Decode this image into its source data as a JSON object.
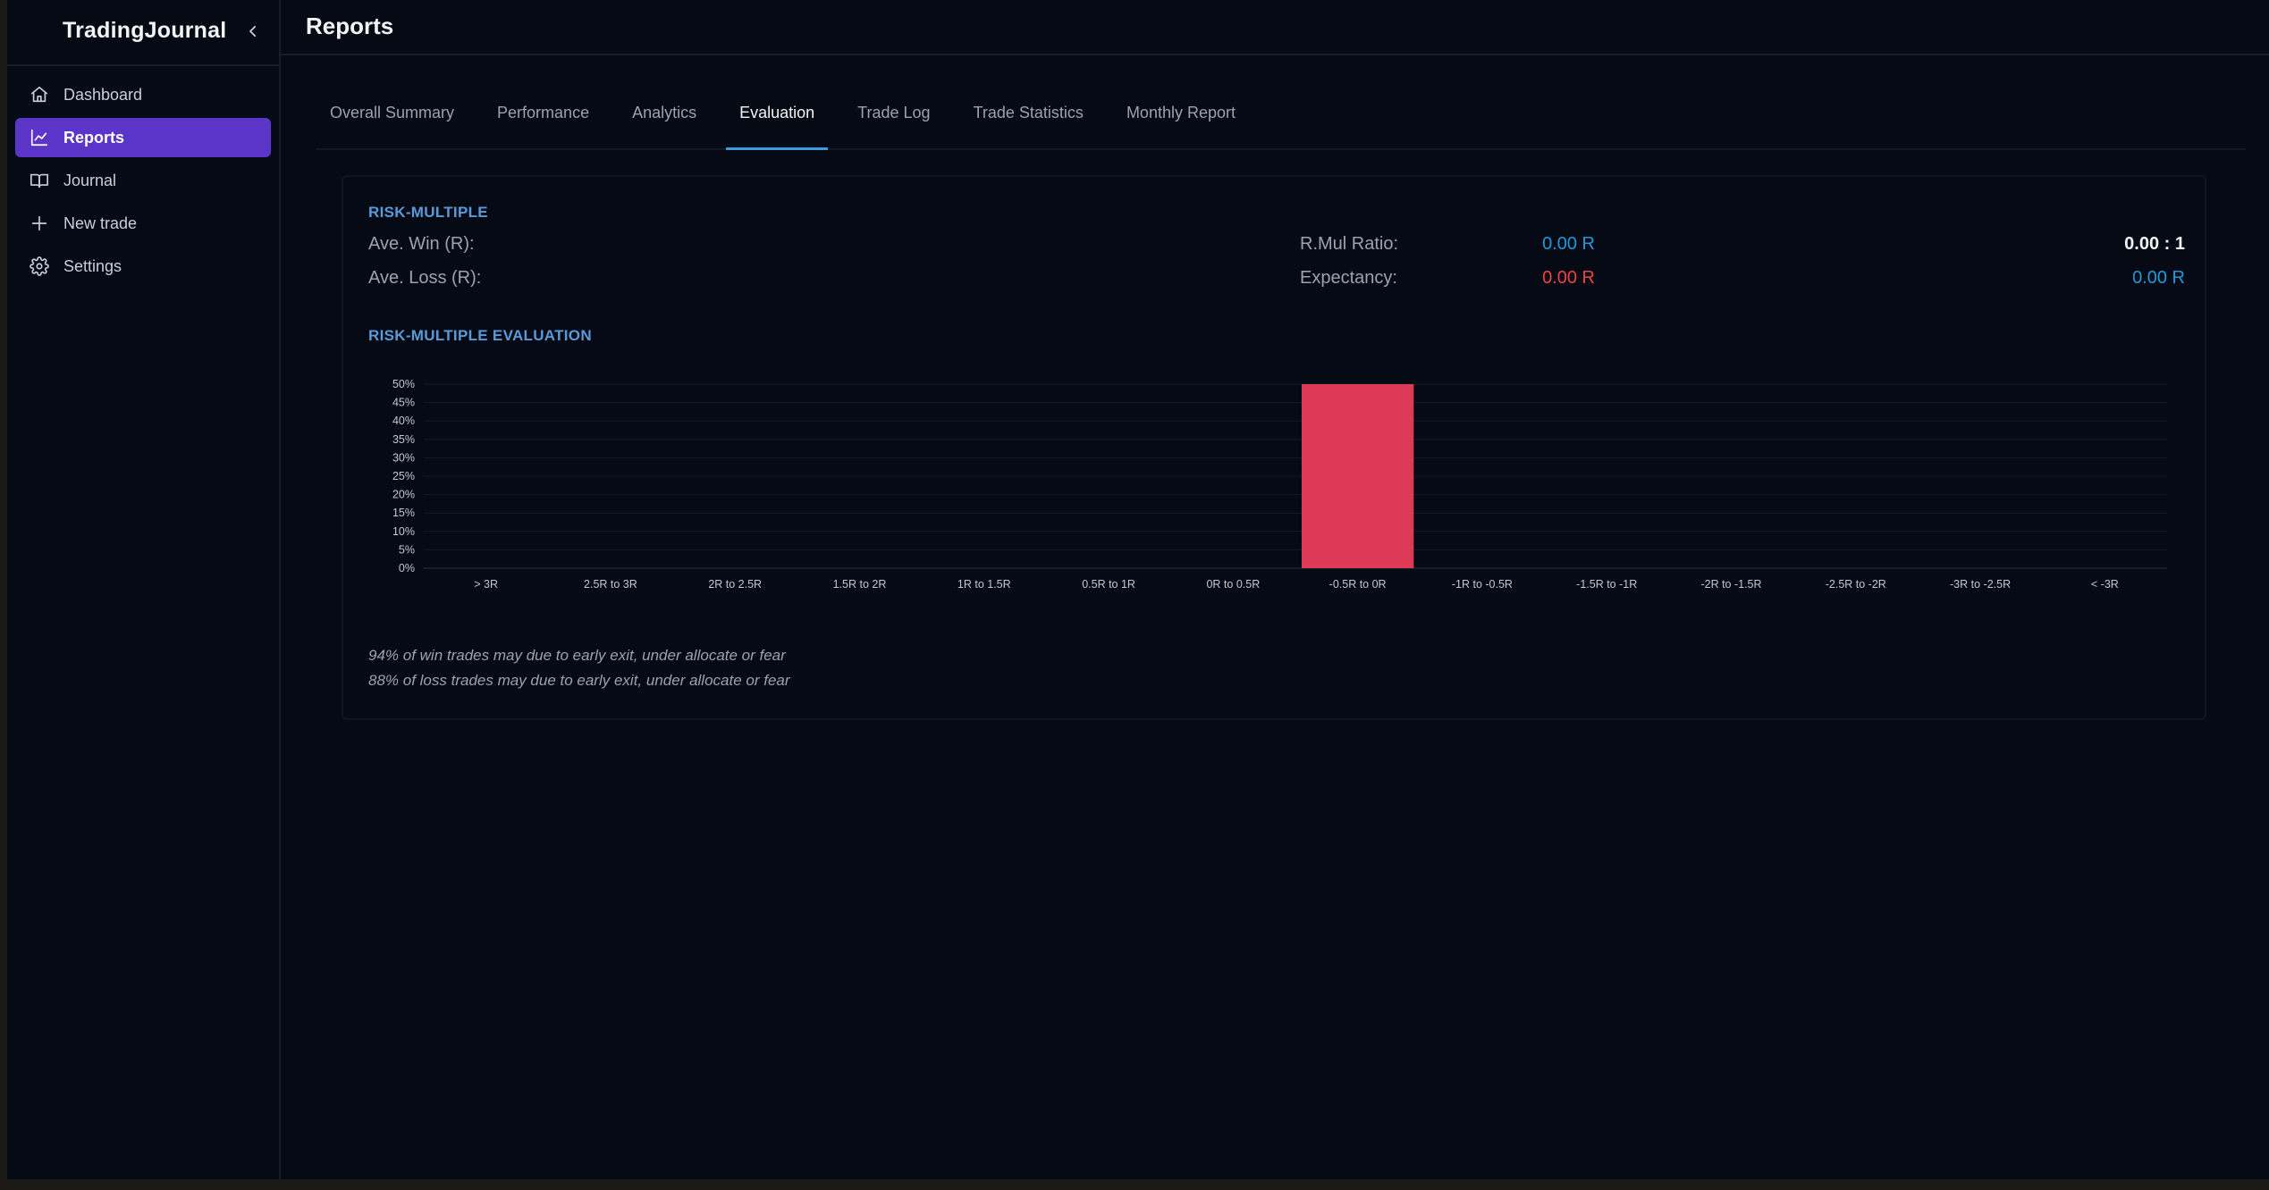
{
  "app": {
    "brand": "TradingJournal"
  },
  "sidebar": {
    "items": [
      {
        "label": "Dashboard",
        "icon": "home-icon"
      },
      {
        "label": "Reports",
        "icon": "chart-line-icon",
        "active": true
      },
      {
        "label": "Journal",
        "icon": "book-icon"
      },
      {
        "label": "New trade",
        "icon": "plus-icon"
      },
      {
        "label": "Settings",
        "icon": "gear-icon"
      }
    ]
  },
  "header": {
    "title": "Reports"
  },
  "tabs": [
    {
      "label": "Overall Summary"
    },
    {
      "label": "Performance"
    },
    {
      "label": "Analytics"
    },
    {
      "label": "Evaluation",
      "active": true
    },
    {
      "label": "Trade Log"
    },
    {
      "label": "Trade Statistics"
    },
    {
      "label": "Monthly Report"
    }
  ],
  "risk_multiple": {
    "title": "RISK-MULTIPLE",
    "ave_win_label": "Ave. Win (R):",
    "ave_win_value": "0.00 R",
    "ave_loss_label": "Ave. Loss (R):",
    "ave_loss_value": "0.00 R",
    "ratio_label": "R.Mul Ratio:",
    "ratio_value": "0.00 : 1",
    "expectancy_label": "Expectancy:",
    "expectancy_value": "0.00 R"
  },
  "evaluation": {
    "title": "RISK-MULTIPLE EVALUATION",
    "notes": [
      "94% of win trades may due to early exit, under allocate or fear",
      "88% of loss trades may due to early exit, under allocate or fear"
    ]
  },
  "colors": {
    "accent": "#5b34c9",
    "positive": "#1e9be0",
    "negative": "#ef4444",
    "bar": "#dc3a57"
  },
  "chart_data": {
    "type": "bar",
    "categories": [
      "> 3R",
      "2.5R to 3R",
      "2R to 2.5R",
      "1.5R to 2R",
      "1R to 1.5R",
      "0.5R to 1R",
      "0R to 0.5R",
      "-0.5R to 0R",
      "-1R to -0.5R",
      "-1.5R to -1R",
      "-2R to -1.5R",
      "-2.5R to -2R",
      "-3R to -2.5R",
      "< -3R"
    ],
    "values": [
      0,
      0,
      0,
      0,
      0,
      0,
      0,
      50,
      0,
      0,
      0,
      0,
      0,
      0
    ],
    "yticks": [
      "0%",
      "5%",
      "10%",
      "15%",
      "20%",
      "25%",
      "30%",
      "35%",
      "40%",
      "45%",
      "50%"
    ],
    "ylim": [
      0,
      50
    ],
    "grid": true,
    "title": "",
    "xlabel": "",
    "ylabel": ""
  }
}
